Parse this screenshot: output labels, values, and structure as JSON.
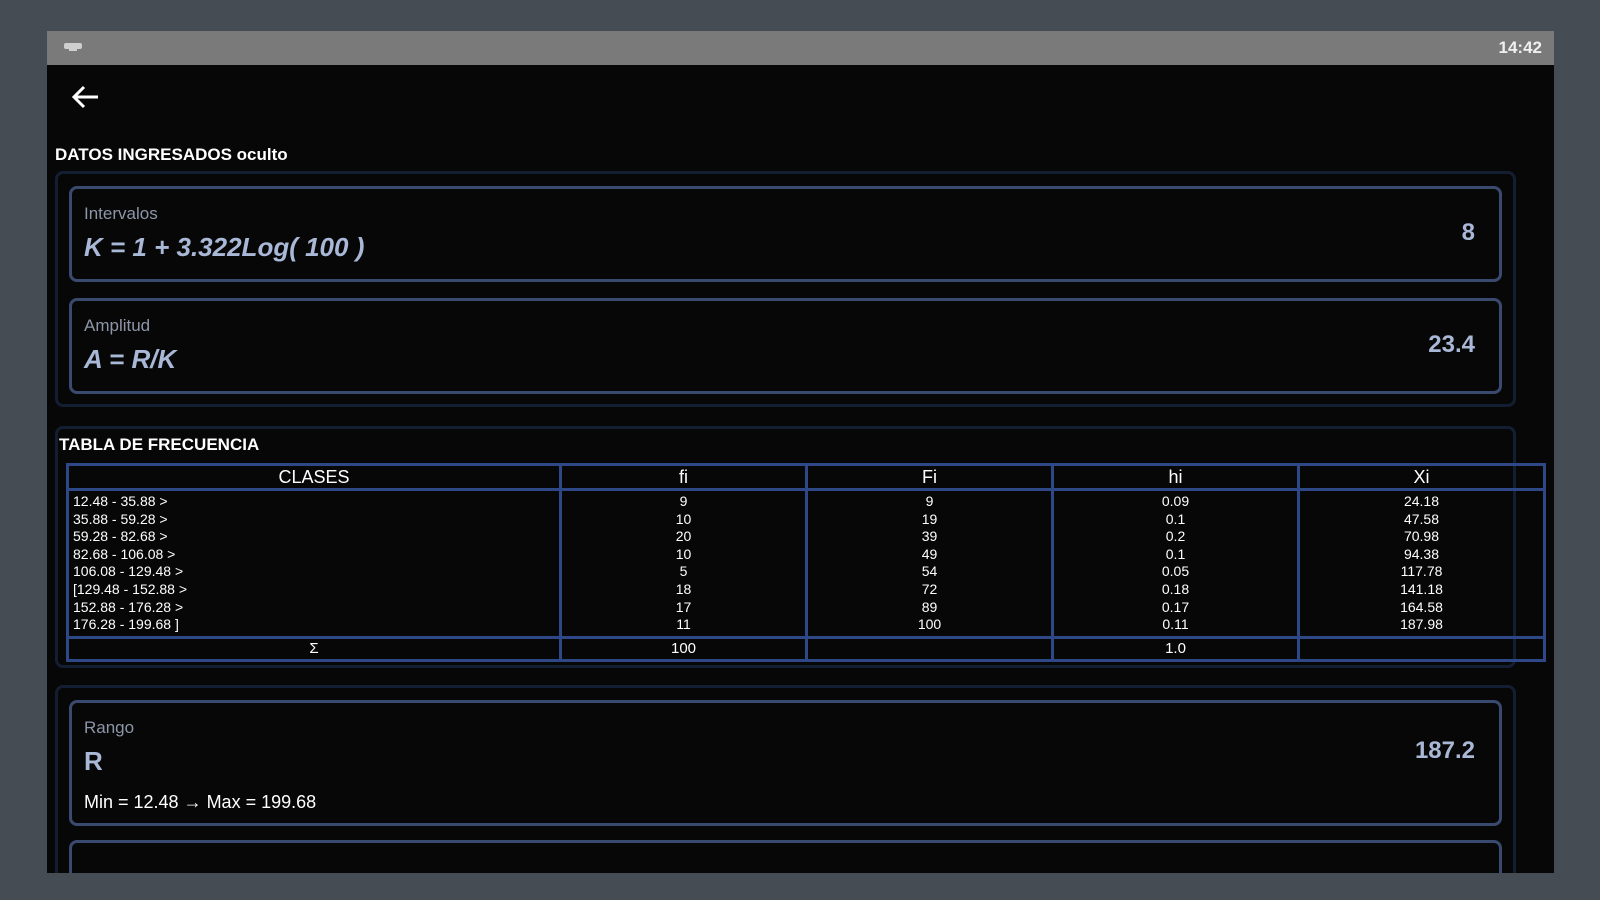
{
  "status_bar": {
    "time": "14:42",
    "icon": "notification-icon"
  },
  "toolbar": {
    "back_icon": "back-arrow-icon"
  },
  "datos": {
    "title": "DATOS INGRESADOS oculto",
    "intervalos": {
      "label": "Intervalos",
      "formula": "K = 1 + 3.322Log( 100 )",
      "value": "8"
    },
    "amplitud": {
      "label": "Amplitud",
      "formula": "A = R/K",
      "value": "23.4"
    }
  },
  "tabla": {
    "title": "TABLA DE FRECUENCIA",
    "headers": [
      "CLASES",
      "fi",
      "Fi",
      "hi",
      "Xi"
    ],
    "rows": [
      [
        "12.48 - 35.88 >",
        "9",
        "9",
        "0.09",
        "24.18"
      ],
      [
        "35.88 - 59.28 >",
        "10",
        "19",
        "0.1",
        "47.58"
      ],
      [
        "59.28 - 82.68 >",
        "20",
        "39",
        "0.2",
        "70.98"
      ],
      [
        "82.68 - 106.08 >",
        "10",
        "49",
        "0.1",
        "94.38"
      ],
      [
        "106.08 - 129.48 >",
        "5",
        "54",
        "0.05",
        "117.78"
      ],
      [
        "[129.48 - 152.88 >",
        "18",
        "72",
        "0.18",
        "141.18"
      ],
      [
        "152.88 - 176.28 >",
        "17",
        "89",
        "0.17",
        "164.58"
      ],
      [
        "176.28 - 199.68 ]",
        "11",
        "100",
        "0.11",
        "187.98"
      ]
    ],
    "sum": [
      "Σ",
      "100",
      "",
      "1.0",
      ""
    ]
  },
  "rango": {
    "label": "Rango",
    "formula": "R",
    "value": "187.2",
    "detail": "Min = 12.48 → Max = 199.68"
  }
}
